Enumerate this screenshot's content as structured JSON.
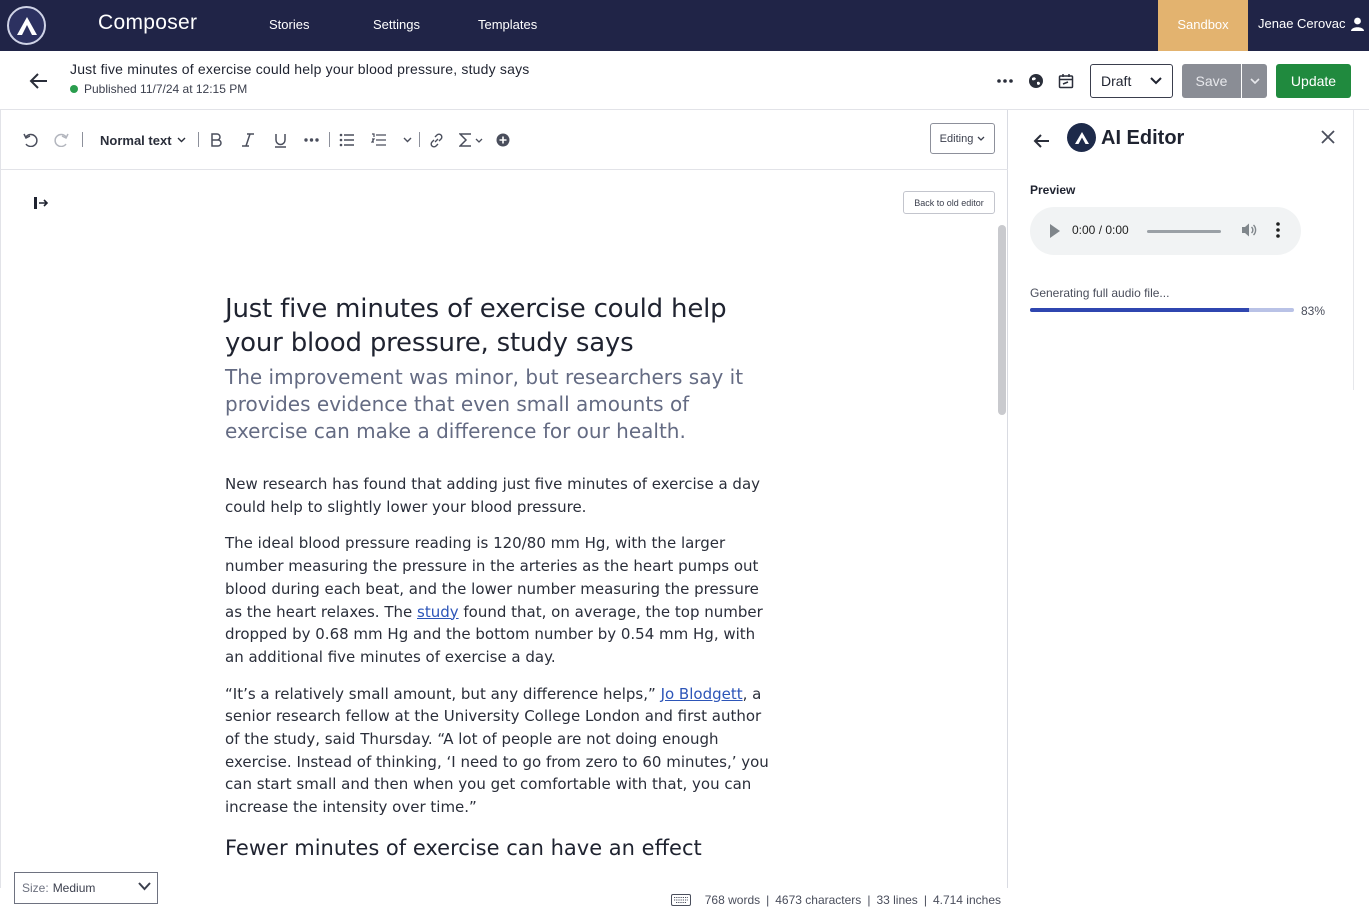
{
  "topnav": {
    "app_name": "Composer",
    "links": [
      "Stories",
      "Settings",
      "Templates"
    ],
    "sandbox_label": "Sandbox",
    "user_name": "Jenae Cerovac"
  },
  "story": {
    "title": "Just five minutes of exercise could help your blood pressure, study says",
    "status": "Published 11/7/24 at 12:15 PM",
    "status_color": "#2a9d4e",
    "workflow_value": "Draft",
    "save_label": "Save",
    "update_label": "Update"
  },
  "toolbar": {
    "text_style": "Normal text",
    "editing_mode": "Editing"
  },
  "canvas": {
    "old_editor_label": "Back to old editor"
  },
  "article": {
    "headline": "Just five minutes of exercise could help your blood pressure, study says",
    "dek": "The improvement was minor, but researchers say it provides evidence that even small amounts of exercise can make a difference for our health.",
    "p1": "New research has found that adding just five minutes of exercise a day could help to slightly lower your blood pressure.",
    "p2_a": "The ideal blood pressure reading is 120/80 mm Hg, with the larger number measuring the pressure in the arteries as the heart pumps out blood during each beat, and the lower number measuring the pressure as the heart relaxes. The ",
    "p2_link": "study",
    "p2_b": " found that, on average, the top number dropped by 0.68 mm Hg and the bottom number by 0.54 mm Hg, with an additional five minutes of exercise a day.",
    "p3_a": "“It’s a relatively small amount, but any difference helps,” ",
    "p3_link": "Jo Blodgett",
    "p3_b": ", a senior research fellow at the University College London and first author of the study, said Thursday. “A lot of people are not doing enough exercise. Instead of thinking, ‘I need to go from zero to 60 minutes,’ you can start small and then when you get comfortable with that, you can increase the intensity over time.”",
    "subhead": "Fewer minutes of exercise can have an effect"
  },
  "footer": {
    "size_label": "Size:",
    "size_value": "Medium",
    "words": "768 words",
    "characters": "4673 characters",
    "lines": "33 lines",
    "inches": "4.714 inches"
  },
  "ai_panel": {
    "title": "AI Editor",
    "preview_label": "Preview",
    "audio_time": "0:00 / 0:00",
    "generating_label": "Generating full audio file...",
    "progress_fraction": 0.83,
    "progress_text": "83%",
    "accent_color": "#2f46b0"
  }
}
